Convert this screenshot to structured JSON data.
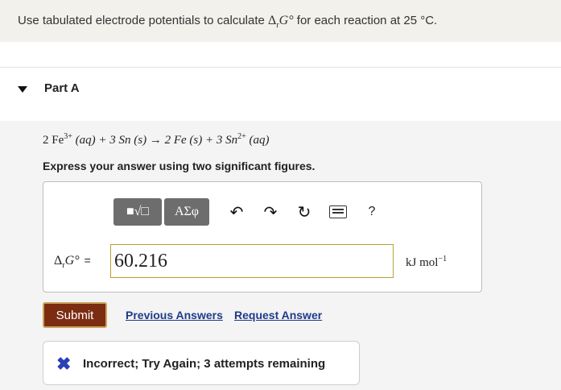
{
  "prompt": {
    "text_before": "Use tabulated electrode potentials to calculate ",
    "delta": "Δ",
    "sub_r": "r",
    "g_symbol": "G°",
    "text_after": " for each reaction at 25 °C."
  },
  "part": {
    "title": "Part A",
    "reaction": {
      "coef1": "2 Fe",
      "charge1": "3+",
      "state1": " (aq) + 3 Sn (s) → 2 Fe (s) + 3 Sn",
      "charge2": "2+",
      "state2": " (aq)"
    },
    "instruction": "Express your answer using two significant figures."
  },
  "toolbar": {
    "templates_label": "■√□",
    "symbols_label": "ΑΣφ",
    "undo_icon": "↶",
    "redo_icon": "↷",
    "reset_icon": "↻",
    "help_label": "?"
  },
  "answer": {
    "label_delta": "Δ",
    "label_sub": "r",
    "label_g": "G°",
    "label_eq": "=",
    "value": "60.216",
    "units_base": "kJ mol",
    "units_exp": "−1"
  },
  "actions": {
    "submit_label": "Submit",
    "previous_answers": "Previous Answers",
    "request_answer": "Request Answer"
  },
  "feedback": {
    "icon": "✖",
    "text": "Incorrect; Try Again; 3 attempts remaining"
  },
  "colors": {
    "submit_bg": "#7c2c11",
    "link": "#1e3a8a",
    "feedback_icon": "#2b3fb8",
    "input_border": "#b8a035"
  }
}
